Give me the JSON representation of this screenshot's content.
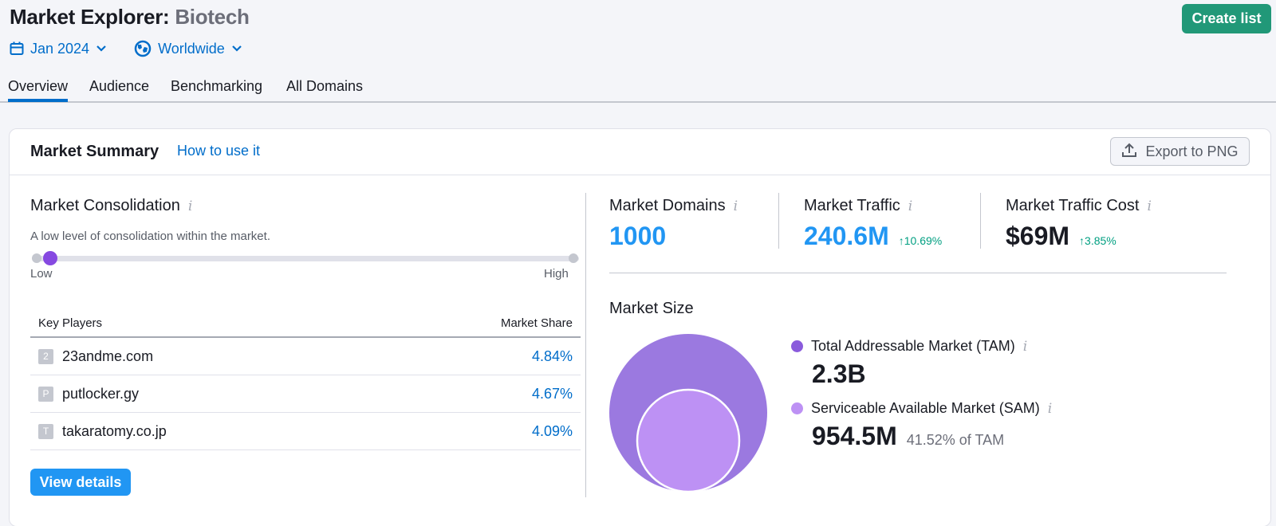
{
  "header": {
    "title_prefix": "Market Explorer:",
    "title_market": "Biotech",
    "create_list_label": "Create list",
    "date_filter": "Jan 2024",
    "region_filter": "Worldwide"
  },
  "tabs": [
    {
      "label": "Overview",
      "active": true
    },
    {
      "label": "Audience",
      "active": false
    },
    {
      "label": "Benchmarking",
      "active": false
    },
    {
      "label": "All Domains",
      "active": false
    }
  ],
  "card": {
    "title": "Market Summary",
    "how_to_link": "How to use it",
    "export_label": "Export to PNG"
  },
  "consolidation": {
    "title": "Market Consolidation",
    "description": "A low level of consolidation within the market.",
    "level_fraction": 0.02,
    "low_label": "Low",
    "high_label": "High"
  },
  "players": {
    "col_player": "Key Players",
    "col_share": "Market Share",
    "rows": [
      {
        "favicon": "2",
        "domain": "23andme.com",
        "share": "4.84%"
      },
      {
        "favicon": "P",
        "domain": "putlocker.gy",
        "share": "4.67%"
      },
      {
        "favicon": "T",
        "domain": "takaratomy.co.jp",
        "share": "4.09%"
      }
    ],
    "view_details_label": "View details"
  },
  "metrics": [
    {
      "label": "Market Domains",
      "value": "1000",
      "delta": ""
    },
    {
      "label": "Market Traffic",
      "value": "240.6M",
      "delta": "↑10.69%"
    },
    {
      "label": "Market Traffic Cost",
      "value": "$69M",
      "delta": "↑3.85%"
    }
  ],
  "market_size": {
    "title": "Market Size",
    "tam": {
      "label": "Total Addressable Market (TAM)",
      "value": "2.3B",
      "color": "#9b79e0"
    },
    "sam": {
      "label": "Serviceable Available Market (SAM)",
      "value": "954.5M",
      "share_of_tam": "41.52% of TAM",
      "color": "#bd91f4"
    }
  },
  "colors": {
    "accent_blue": "#006dca",
    "value_blue": "#2196f3",
    "green": "#219878",
    "delta_green": "#009f81",
    "slider_purple": "#8649e1"
  }
}
